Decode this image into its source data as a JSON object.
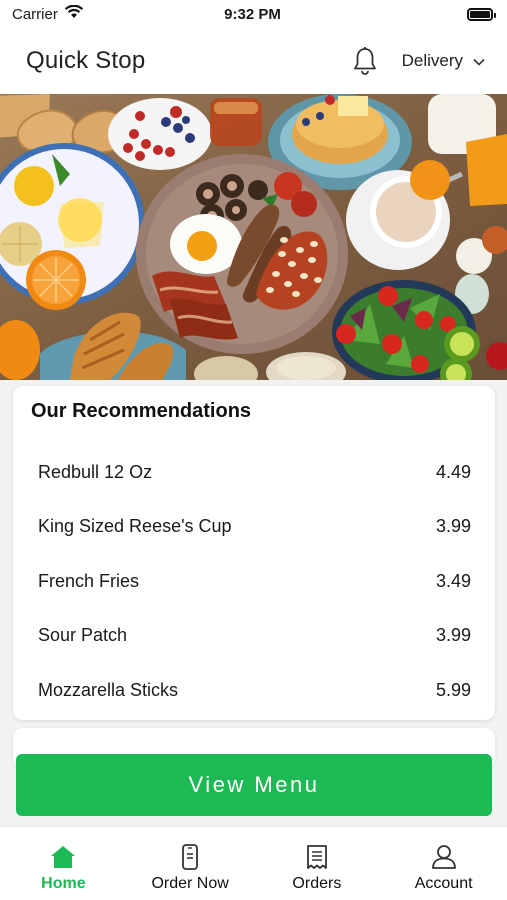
{
  "status_bar": {
    "carrier": "Carrier",
    "time": "9:32 PM"
  },
  "header": {
    "store_name": "Quick Stop",
    "fulfillment_mode": "Delivery"
  },
  "recommendations": {
    "title": "Our Recommendations",
    "items": [
      {
        "name": "Redbull 12 Oz",
        "price": "4.49"
      },
      {
        "name": "King Sized Reese's Cup",
        "price": "3.99"
      },
      {
        "name": "French Fries",
        "price": "3.49"
      },
      {
        "name": "Sour Patch",
        "price": "3.99"
      },
      {
        "name": "Mozzarella Sticks",
        "price": "5.99"
      }
    ]
  },
  "cta": {
    "label": "View Menu"
  },
  "tabbar": {
    "tabs": [
      {
        "label": "Home",
        "icon": "home-icon",
        "active": true
      },
      {
        "label": "Order Now",
        "icon": "phone-icon",
        "active": false
      },
      {
        "label": "Orders",
        "icon": "receipt-icon",
        "active": false
      },
      {
        "label": "Account",
        "icon": "person-icon",
        "active": false
      }
    ]
  },
  "colors": {
    "accent": "#1db954",
    "background": "#f2f2f2",
    "card": "#ffffff"
  }
}
